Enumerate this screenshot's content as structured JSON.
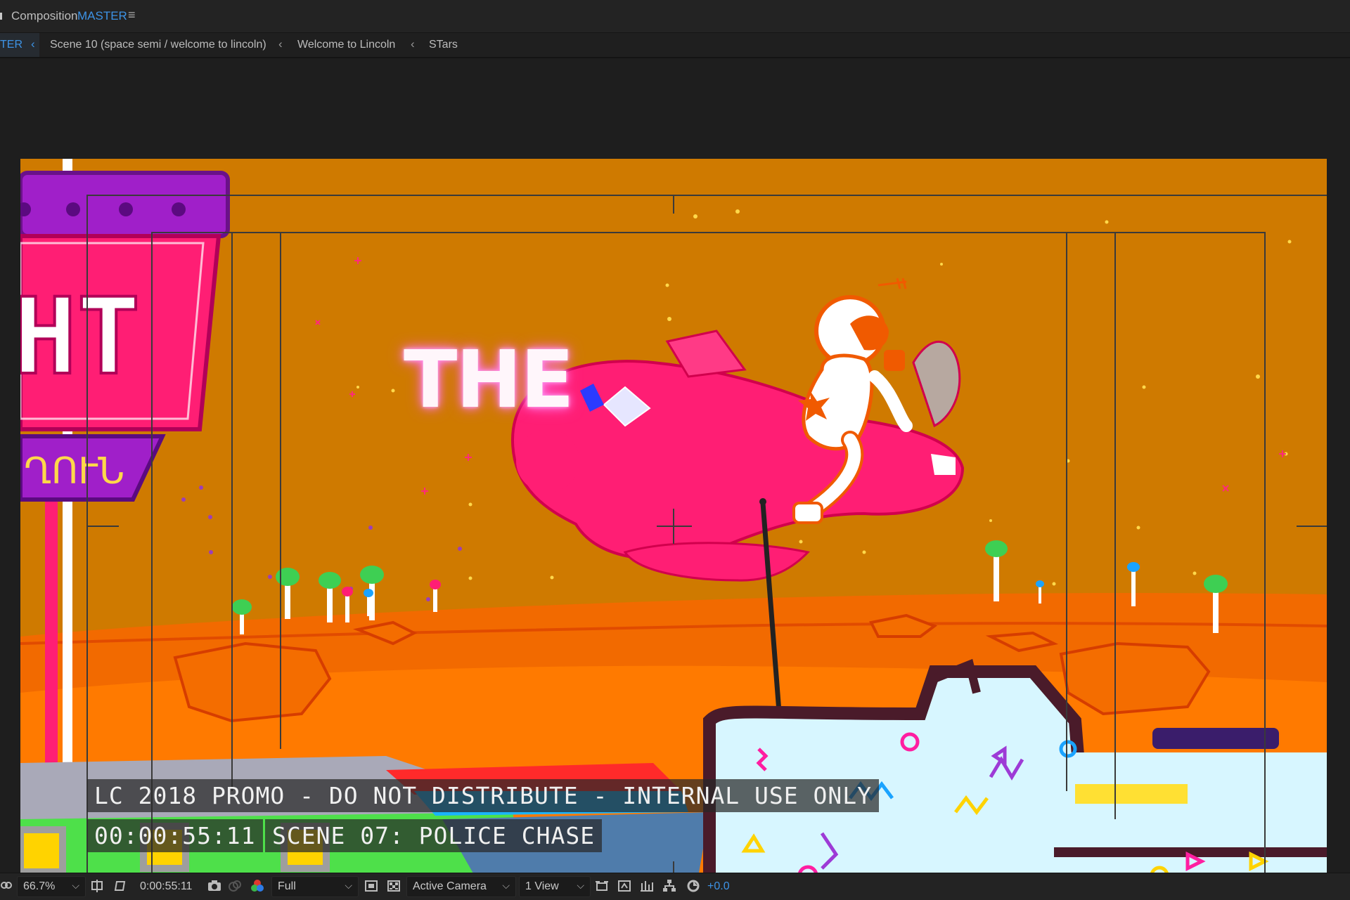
{
  "titlebar": {
    "label": "Composition",
    "comp_name": "MASTER",
    "menu_icon": "hamburger-icon"
  },
  "breadcrumbs": [
    {
      "label": "TER",
      "active": true
    },
    {
      "label": "Scene 10 (space semi / welcome to lincoln)",
      "active": false
    },
    {
      "label": "Welcome to Lincoln",
      "active": false
    },
    {
      "label": "STars",
      "active": false
    }
  ],
  "viewer": {
    "headline_text": "THE",
    "sign_text": "HT",
    "sign_sub_text": "ՂՈՒՆ",
    "burnin": {
      "title": "LC 2018 PROMO - DO NOT DISTRIBUTE - INTERNAL USE ONLY",
      "timecode": "00:00:55:11",
      "scene": "SCENE 07: POLICE CHASE"
    }
  },
  "statusbar": {
    "zoom": "66.7%",
    "timecode": "0:00:55:11",
    "resolution": "Full",
    "camera": "Active Camera",
    "views": "1 View",
    "exposure": "+0.0"
  },
  "colors": {
    "accent": "#3d93e6",
    "canvas_bg": "#cf7a00",
    "ship": "#ff1e74"
  }
}
